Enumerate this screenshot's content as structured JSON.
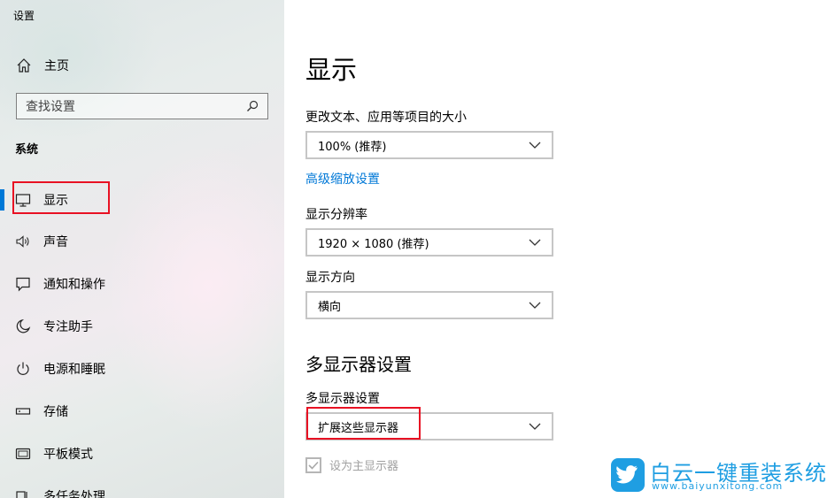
{
  "window": {
    "title": "设置"
  },
  "sidebar": {
    "home_label": "主页",
    "search_placeholder": "查找设置",
    "section_title": "系统",
    "items": [
      {
        "label": "显示",
        "icon": "monitor-icon",
        "active": true
      },
      {
        "label": "声音",
        "icon": "speaker-icon"
      },
      {
        "label": "通知和操作",
        "icon": "message-icon"
      },
      {
        "label": "专注助手",
        "icon": "moon-icon"
      },
      {
        "label": "电源和睡眠",
        "icon": "power-icon"
      },
      {
        "label": "存储",
        "icon": "storage-icon"
      },
      {
        "label": "平板模式",
        "icon": "tablet-icon"
      },
      {
        "label": "多任务处理",
        "icon": "multitask-icon"
      }
    ]
  },
  "main": {
    "page_title": "显示",
    "scale": {
      "label": "更改文本、应用等项目的大小",
      "value": "100% (推荐)",
      "advanced_link": "高级缩放设置"
    },
    "resolution": {
      "label": "显示分辨率",
      "value": "1920 × 1080 (推荐)"
    },
    "orientation": {
      "label": "显示方向",
      "value": "横向"
    },
    "multi_display": {
      "heading": "多显示器设置",
      "label": "多显示器设置",
      "value": "扩展这些显示器",
      "primary_checkbox_label": "设为主显示器",
      "primary_checked": true
    }
  },
  "watermark": {
    "name": "白云一键重装系统",
    "url": "www.baiyunxitong.com"
  },
  "colors": {
    "accent": "#0078d7",
    "highlight": "#e81123",
    "watermark": "#1f9ee2"
  }
}
